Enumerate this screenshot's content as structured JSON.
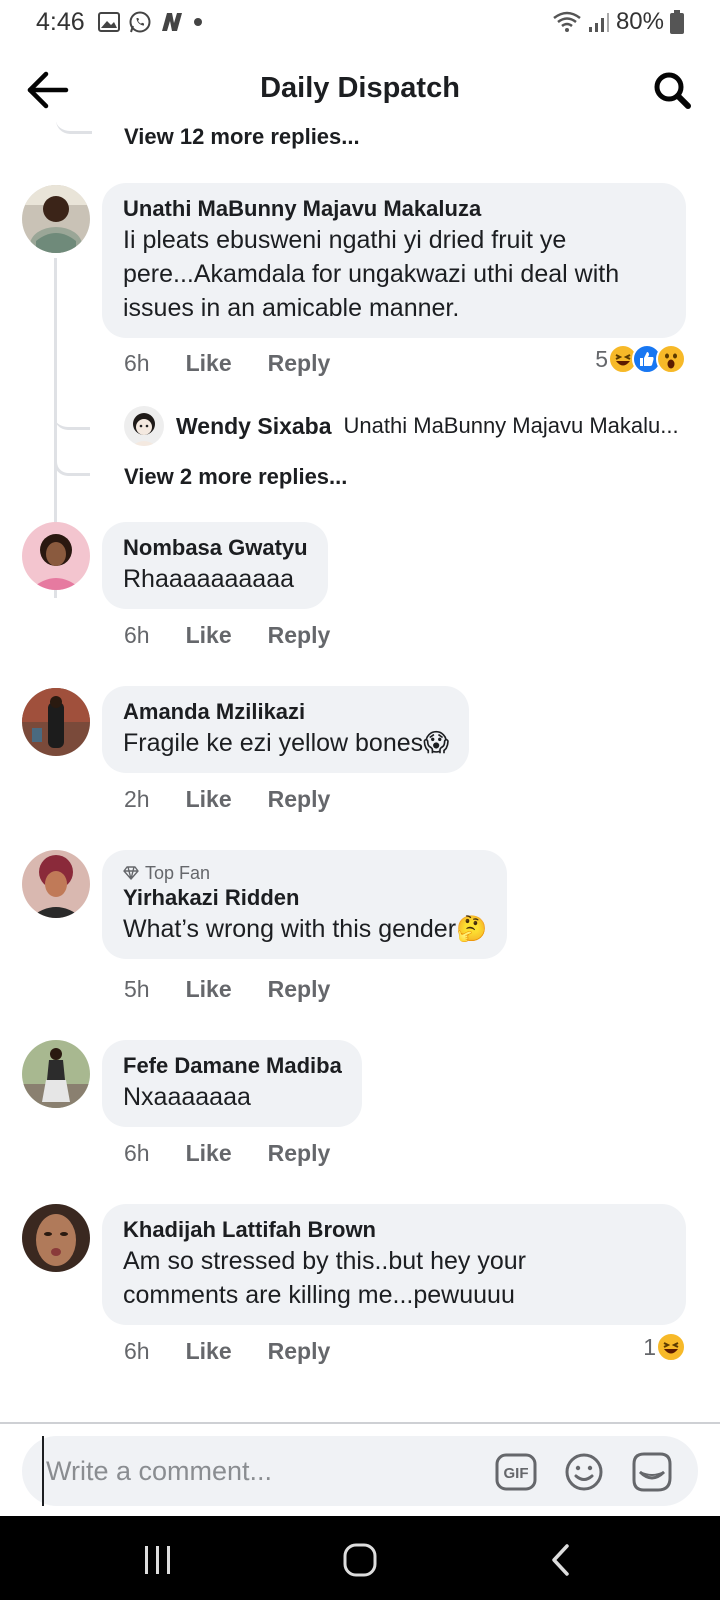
{
  "status_bar": {
    "time": "4:46",
    "battery": "80%"
  },
  "header": {
    "title": "Daily Dispatch"
  },
  "thread": {
    "view_more_top": "View 12 more replies...",
    "view_more_reply": "View 2 more replies...",
    "reply_preview": {
      "name": "Wendy Sixaba",
      "text": "Unathi MaBunny Majavu Makalu..."
    }
  },
  "comments": [
    {
      "name": "Unathi MaBunny Majavu Makaluza",
      "lines": [
        "Ii pleats ebusweni ngathi yi dried fruit ye",
        "pere...Akamdala for ungakwazi uthi deal with",
        "issues in an amicable manner."
      ],
      "time": "6h",
      "like": "Like",
      "reply": "Reply",
      "reaction_count": "5"
    },
    {
      "name": "Nombasa Gwatyu",
      "lines": [
        "Rhaaaaaaaaaa"
      ],
      "time": "6h",
      "like": "Like",
      "reply": "Reply"
    },
    {
      "name": "Amanda Mzilikazi",
      "lines": [
        "Fragile ke ezi yellow bones😱"
      ],
      "time": "2h",
      "like": "Like",
      "reply": "Reply"
    },
    {
      "badge": "Top Fan",
      "name": "Yirhakazi Ridden",
      "lines": [
        "What’s wrong with this gender🤔"
      ],
      "time": "5h",
      "like": "Like",
      "reply": "Reply"
    },
    {
      "name": "Fefe Damane Madiba",
      "lines": [
        "Nxaaaaaaa"
      ],
      "time": "6h",
      "like": "Like",
      "reply": "Reply"
    },
    {
      "name": "Khadijah Lattifah Brown",
      "lines": [
        "Am so stressed by this..but hey your",
        "comments are killing me...pewuuuu"
      ],
      "time": "6h",
      "like": "Like",
      "reply": "Reply",
      "reaction_count": "1"
    }
  ],
  "composer": {
    "placeholder": "Write a comment...",
    "gif_label": "GIF"
  },
  "colors": {
    "bubble": "#f0f2f5",
    "meta": "#65676b",
    "like_blue": "#1877f2",
    "haha_yellow": "#f7b928"
  }
}
